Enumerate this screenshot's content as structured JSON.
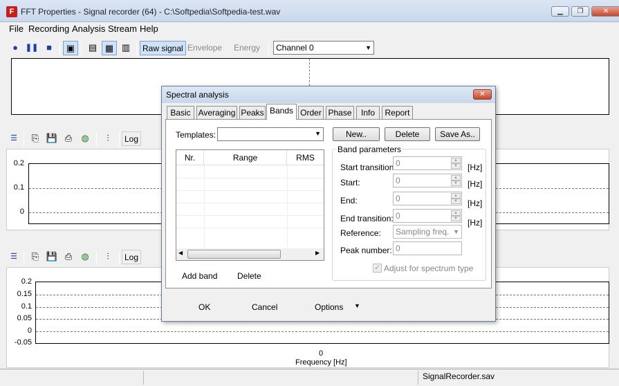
{
  "window": {
    "title": "FFT Properties - Signal recorder (64)  -  C:\\Softpedia\\Softpedia-test.wav",
    "minimize": "▁",
    "restore": "❐",
    "close": "✕"
  },
  "menu": [
    "File",
    "Recording",
    "Analysis",
    "Stream",
    "Help"
  ],
  "toolbar": {
    "raw": "Raw signal",
    "envelope": "Envelope",
    "energy": "Energy",
    "channel": "Channel 0"
  },
  "panel_tools": {
    "log": "Log"
  },
  "plot2": {
    "yticks": [
      "0.2",
      "0.1",
      "0"
    ]
  },
  "plot3": {
    "yticks": [
      "0.2",
      "0.15",
      "0.1",
      "0.05",
      "0",
      "-0.05"
    ],
    "xtick": "0",
    "xlabel": "Frequency [Hz]"
  },
  "dialog": {
    "title": "Spectral analysis",
    "close": "✕",
    "tabs": [
      "Basic",
      "Averaging",
      "Peaks",
      "Bands",
      "Order",
      "Phase",
      "Info",
      "Report"
    ],
    "templates_label": "Templates:",
    "new": "New..",
    "delete": "Delete",
    "save_as": "Save As..",
    "columns": [
      "Nr.",
      "Range",
      "RMS"
    ],
    "add_band": "Add band",
    "delete_band": "Delete",
    "group": "Band parameters",
    "params": [
      {
        "label": "Start transition:",
        "value": "0",
        "unit": "[Hz]"
      },
      {
        "label": "Start:",
        "value": "0",
        "unit": "[Hz]"
      },
      {
        "label": "End:",
        "value": "0",
        "unit": "[Hz]"
      },
      {
        "label": "End transition:",
        "value": "0",
        "unit": "[Hz]"
      }
    ],
    "reference_label": "Reference:",
    "reference_value": "Sampling freq.",
    "peak_label": "Peak number:",
    "peak_value": "0",
    "adjust": "Adjust for spectrum type",
    "ok": "OK",
    "cancel": "Cancel",
    "options": "Options"
  },
  "status": {
    "file": "SignalRecorder.sav"
  },
  "colors": {
    "accent": "#cfe2f7",
    "plot_bg": "#ffffff"
  }
}
